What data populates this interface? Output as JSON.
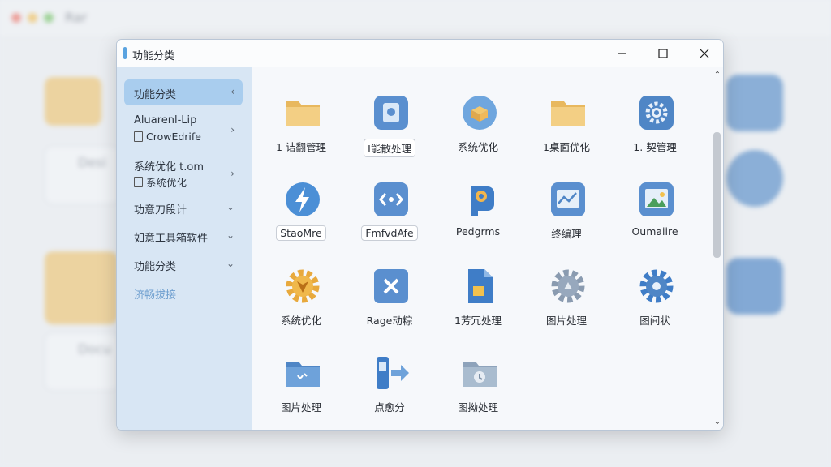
{
  "background": {
    "app_title": "Rar",
    "items": [
      "Desi",
      "Docu"
    ]
  },
  "dialog": {
    "title": "功能分类",
    "controls": {
      "minimize": "—",
      "maximize": "☐",
      "close": "✕"
    }
  },
  "sidebar": {
    "items": [
      {
        "label": "功能分类",
        "chevron": "‹"
      },
      {
        "label": "Aluarenl-Lip",
        "sub": "CrowEdrife",
        "chevron": "›"
      },
      {
        "label": "系统优化   t.om",
        "sub": "系统优化",
        "chevron": "›"
      },
      {
        "label": "功意刀段计",
        "chevron": "⌄"
      },
      {
        "label": "如意工具箱软件",
        "chevron": "⌄"
      },
      {
        "label": "功能分类",
        "chevron": "⌄"
      },
      {
        "label": "济畅拔接"
      }
    ]
  },
  "grid": {
    "tiles": [
      {
        "label": "1 诘翻管理",
        "icon": "folder-icon"
      },
      {
        "label": "Ⅰ能散处理",
        "icon": "image-app-icon"
      },
      {
        "label": "系统优化",
        "icon": "cloud-box-icon"
      },
      {
        "label": "1桌面优化",
        "icon": "folder-icon"
      },
      {
        "label": "1. 契管理",
        "icon": "gear-icon"
      },
      {
        "label": "StaoMre",
        "icon": "lightning-icon"
      },
      {
        "label": "FmfvdAfe",
        "icon": "code-icon"
      },
      {
        "label": "Pedgrms",
        "icon": "brain-icon"
      },
      {
        "label": "终编理",
        "icon": "chart-icon"
      },
      {
        "label": "Oumaiire",
        "icon": "picture-icon"
      },
      {
        "label": "系统优化",
        "icon": "orange-gear-icon"
      },
      {
        "label": "Rage动粽",
        "icon": "x-tool-icon"
      },
      {
        "label": "1芳冗处理",
        "icon": "document-icon"
      },
      {
        "label": "图片处理",
        "icon": "gray-gear-icon"
      },
      {
        "label": "图间状",
        "icon": "blue-gear-icon"
      },
      {
        "label": "图片处理",
        "icon": "blue-folder-icon"
      },
      {
        "label": "点愈分",
        "icon": "device-arrow-icon"
      },
      {
        "label": "图拗处理",
        "icon": "gray-folder-icon"
      }
    ]
  },
  "scrollbar": {
    "up": "⌃",
    "down": "⌄"
  }
}
